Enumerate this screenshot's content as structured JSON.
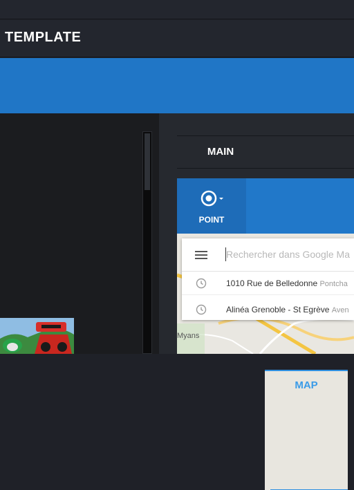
{
  "header": {
    "title": "TEMPLATE"
  },
  "tabs": [
    {
      "label": "MAIN"
    },
    {
      "label": "MAP"
    }
  ],
  "toolbar": {
    "point_label": "POINT",
    "point_icon": "target-icon"
  },
  "search": {
    "placeholder": "Rechercher dans Google Ma",
    "suggestions": [
      {
        "main": "1010 Rue de Belledonne",
        "secondary": "Pontcha"
      },
      {
        "main": "Alinéa Grenoble - St Egrève",
        "secondary": "Aven"
      }
    ]
  },
  "map": {
    "labels": [
      "Myans"
    ]
  },
  "colors": {
    "accent": "#2076c6",
    "tab_active": "#3a9be8"
  }
}
